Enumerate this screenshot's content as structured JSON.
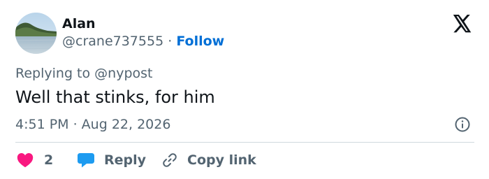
{
  "user": {
    "name": "Alan",
    "handle": "@crane737555",
    "separator": "·",
    "follow_label": "Follow"
  },
  "brand_icon": "x-logo-icon",
  "reply_context": "Replying to @nypost",
  "tweet": {
    "text": "Well that stinks, for him",
    "timestamp": "4:51 PM · Aug 22, 2026"
  },
  "actions": {
    "likes_count": "2",
    "reply_label": "Reply",
    "copy_link_label": "Copy link"
  },
  "colors": {
    "like": "#f91880",
    "reply": "#1d9bf0",
    "link": "#006fd6",
    "muted": "#536471",
    "text": "#0f1419"
  }
}
